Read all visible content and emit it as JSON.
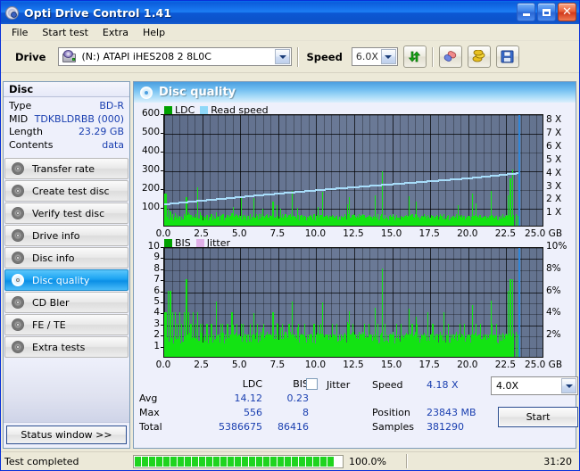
{
  "window": {
    "title": "Opti Drive Control 1.41",
    "icon": "disc-icon",
    "buttons": {
      "minimize": "minimize-icon",
      "maximize": "maximize-icon",
      "close": "close-icon"
    }
  },
  "menu": {
    "items": [
      "File",
      "Start test",
      "Extra",
      "Help"
    ]
  },
  "toolbar": {
    "drive_label": "Drive",
    "drive_value": "(N:)  ATAPI iHES208  2 8L0C",
    "speed_label": "Speed",
    "speed_value": "6.0X",
    "refresh_icon": "refresh-icon",
    "eraser_icon": "eraser-icon",
    "coins_icon": "coins-icon",
    "save_icon": "save-icon"
  },
  "sidebar": {
    "disc_header": "Disc",
    "disc_info": [
      {
        "key": "Type",
        "value": "BD-R"
      },
      {
        "key": "MID",
        "value": "TDKBLDRBB (000)"
      },
      {
        "key": "Length",
        "value": "23.29 GB"
      },
      {
        "key": "Contents",
        "value": "data"
      }
    ],
    "items": [
      {
        "label": "Transfer rate",
        "active": false
      },
      {
        "label": "Create test disc",
        "active": false
      },
      {
        "label": "Verify test disc",
        "active": false
      },
      {
        "label": "Drive info",
        "active": false
      },
      {
        "label": "Disc info",
        "active": false
      },
      {
        "label": "Disc quality",
        "active": true
      },
      {
        "label": "CD Bler",
        "active": false
      },
      {
        "label": "FE / TE",
        "active": false
      },
      {
        "label": "Extra tests",
        "active": false
      }
    ],
    "status_window_label": "Status window >>"
  },
  "panel": {
    "title": "Disc quality",
    "icon": "disc-quality-icon"
  },
  "stats": {
    "col_ldc": "LDC",
    "col_bis": "BIS",
    "rows": [
      {
        "label": "Avg",
        "ldc": "14.12",
        "bis": "0.23"
      },
      {
        "label": "Max",
        "ldc": "556",
        "bis": "8"
      },
      {
        "label": "Total",
        "ldc": "5386675",
        "bis": "86416"
      }
    ],
    "jitter_label": "Jitter",
    "jitter_checked": false,
    "speed_label": "Speed",
    "speed_value": "4.18 X",
    "position_label": "Position",
    "position_value": "23843 MB",
    "samples_label": "Samples",
    "samples_value": "381290",
    "speed_select": "4.0X",
    "start_label": "Start"
  },
  "statusbar": {
    "message": "Test completed",
    "percent": "100.0%",
    "elapsed": "31:20",
    "progress_value": 100
  },
  "chart_data": [
    {
      "id": "ldc-chart",
      "type": "bar",
      "title": "",
      "legend": [
        {
          "name": "LDC",
          "color": "#00a000"
        },
        {
          "name": "Read speed",
          "color": "#8fd8f8"
        }
      ],
      "legend_position": "top-left",
      "xlabel": "GB",
      "ylabel": "",
      "xlim": [
        0,
        25
      ],
      "ylim": [
        0,
        600
      ],
      "xticks": [
        0.0,
        2.5,
        5.0,
        7.5,
        10.0,
        12.5,
        15.0,
        17.5,
        20.0,
        22.5,
        25.0
      ],
      "xticklabels": [
        "0.0",
        "2.5",
        "5.0",
        "7.5",
        "10.0",
        "12.5",
        "15.0",
        "17.5",
        "20.0",
        "22.5",
        "25.0 GB"
      ],
      "yticks": [
        100,
        200,
        300,
        400,
        500,
        600
      ],
      "yticklabels": [
        "100",
        "200",
        "300",
        "400",
        "500",
        "600"
      ],
      "y2lim": [
        0,
        8.5
      ],
      "y2ticks": [
        1,
        2,
        3,
        4,
        5,
        6,
        7,
        8
      ],
      "y2ticklabels": [
        "1 X",
        "2 X",
        "3 X",
        "4 X",
        "5 X",
        "6 X",
        "7 X",
        "8 X"
      ],
      "grid": true,
      "data_end_x": 23.29,
      "series": [
        {
          "name": "LDC",
          "color": "#13e313",
          "note": "error counts per sample across disc",
          "x": [
            0.05,
            0.2,
            0.35,
            0.5,
            0.65,
            0.8,
            0.95,
            1.1,
            1.25,
            1.4,
            1.55,
            1.7,
            1.85,
            2.0,
            2.15,
            2.3,
            2.45,
            2.6,
            2.75,
            2.9,
            3.05,
            3.2,
            3.35,
            3.5,
            3.65,
            3.8,
            3.95,
            4.1,
            4.25,
            4.4,
            4.55,
            4.7,
            4.85,
            5.0,
            5.15,
            5.3,
            5.45,
            5.6,
            5.75,
            5.9,
            6.05,
            6.2,
            6.35,
            6.5,
            6.65,
            6.8,
            6.95,
            7.1,
            7.25,
            7.4,
            7.55,
            7.7,
            7.85,
            8.0,
            8.15,
            8.3,
            8.45,
            8.6,
            8.75,
            8.9,
            9.05,
            9.2,
            9.35,
            9.5,
            9.65,
            9.8,
            9.95,
            10.1,
            10.25,
            10.4,
            10.55,
            10.7,
            10.85,
            11.0,
            11.15,
            11.3,
            11.45,
            11.6,
            11.75,
            11.9,
            12.05,
            12.2,
            12.35,
            12.5,
            12.65,
            12.8,
            12.95,
            13.1,
            13.25,
            13.4,
            13.55,
            13.7,
            13.85,
            14.0,
            14.15,
            14.3,
            14.45,
            14.6,
            14.75,
            14.9,
            15.05,
            15.2,
            15.35,
            15.5,
            15.65,
            15.8,
            15.95,
            16.1,
            16.25,
            16.4,
            16.55,
            16.7,
            16.85,
            17.0,
            17.15,
            17.3,
            17.45,
            17.6,
            17.75,
            17.9,
            18.05,
            18.2,
            18.35,
            18.5,
            18.65,
            18.8,
            18.95,
            19.1,
            19.25,
            19.4,
            19.55,
            19.7,
            19.85,
            20.0,
            20.15,
            20.3,
            20.45,
            20.6,
            20.75,
            20.9,
            21.05,
            21.2,
            21.35,
            21.5,
            21.65,
            21.8,
            21.95,
            22.1,
            22.25,
            22.4,
            22.55,
            22.7,
            22.85,
            23.0,
            23.15,
            23.25
          ],
          "y": [
            170,
            92,
            74,
            60,
            66,
            56,
            52,
            48,
            62,
            150,
            70,
            58,
            50,
            64,
            205,
            72,
            54,
            48,
            56,
            44,
            60,
            52,
            70,
            46,
            54,
            62,
            44,
            58,
            50,
            66,
            48,
            56,
            44,
            150,
            58,
            46,
            52,
            64,
            48,
            42,
            54,
            60,
            46,
            52,
            58,
            44,
            50,
            130,
            46,
            54,
            48,
            62,
            50,
            44,
            56,
            48,
            52,
            46,
            58,
            50,
            44,
            54,
            48,
            52,
            46,
            60,
            50,
            44,
            56,
            48,
            52,
            46,
            50,
            58,
            44,
            54,
            48,
            52,
            46,
            50,
            60,
            44,
            56,
            48,
            52,
            46,
            50,
            58,
            44,
            54,
            48,
            52,
            46,
            60,
            50,
            290,
            56,
            48,
            52,
            46,
            50,
            58,
            44,
            54,
            48,
            52,
            46,
            50,
            60,
            44,
            56,
            48,
            52,
            46,
            50,
            58,
            44,
            54,
            48,
            52,
            46,
            50,
            60,
            44,
            56,
            48,
            52,
            46,
            110,
            58,
            44,
            54,
            48,
            52,
            46,
            50,
            120,
            44,
            56,
            48,
            52,
            46,
            50,
            58,
            44,
            54,
            48,
            52,
            46,
            50,
            160,
            250,
            300
          ]
        },
        {
          "name": "Read speed",
          "color": "#a8ddfa",
          "note": "CAV read speed ramp, X units",
          "x": [
            0,
            1,
            2,
            3,
            4,
            5,
            6,
            7,
            8,
            9,
            10,
            11,
            12,
            13,
            14,
            15,
            16,
            17,
            18,
            19,
            20,
            21,
            22,
            23,
            23.29
          ],
          "y_x": [
            1.82,
            1.93,
            2.05,
            2.15,
            2.26,
            2.37,
            2.48,
            2.58,
            2.68,
            2.78,
            2.88,
            2.98,
            3.07,
            3.16,
            3.25,
            3.34,
            3.43,
            3.52,
            3.61,
            3.7,
            3.79,
            3.9,
            4.02,
            4.14,
            4.18
          ]
        }
      ]
    },
    {
      "id": "bis-chart",
      "type": "bar",
      "title": "",
      "legend": [
        {
          "name": "BIS",
          "color": "#00a000"
        },
        {
          "name": "Jitter",
          "color": "#e0b0e8"
        }
      ],
      "legend_position": "top-left",
      "xlabel": "GB",
      "ylabel": "",
      "xlim": [
        0,
        25
      ],
      "ylim": [
        0,
        10
      ],
      "xticks": [
        0.0,
        2.5,
        5.0,
        7.5,
        10.0,
        12.5,
        15.0,
        17.5,
        20.0,
        22.5,
        25.0
      ],
      "xticklabels": [
        "0.0",
        "2.5",
        "5.0",
        "7.5",
        "10.0",
        "12.5",
        "15.0",
        "17.5",
        "20.0",
        "22.5",
        "25.0 GB"
      ],
      "yticks": [
        1,
        2,
        3,
        4,
        5,
        6,
        7,
        8,
        9,
        10
      ],
      "yticklabels": [
        "1",
        "2",
        "3",
        "4",
        "5",
        "6",
        "7",
        "8",
        "9",
        "10"
      ],
      "y2lim": [
        0,
        10
      ],
      "y2ticks": [
        2,
        4,
        6,
        8,
        10
      ],
      "y2ticklabels": [
        "2%",
        "4%",
        "6%",
        "8%",
        "10%"
      ],
      "grid": true,
      "data_end_x": 23.29,
      "series": [
        {
          "name": "BIS",
          "color": "#13e313",
          "note": "burst indicator subcode errors per sample",
          "x": [
            0.05,
            0.2,
            0.35,
            0.5,
            0.65,
            0.8,
            0.95,
            1.1,
            1.25,
            1.4,
            1.55,
            1.7,
            1.85,
            2.0,
            2.15,
            2.3,
            2.45,
            2.6,
            2.75,
            2.9,
            3.05,
            3.2,
            3.35,
            3.5,
            3.65,
            3.8,
            3.95,
            4.1,
            4.25,
            4.4,
            4.55,
            4.7,
            4.85,
            5.0,
            5.15,
            5.3,
            5.45,
            5.6,
            5.75,
            5.9,
            6.05,
            6.2,
            6.35,
            6.5,
            6.65,
            6.8,
            6.95,
            7.1,
            7.25,
            7.4,
            7.55,
            7.7,
            7.85,
            8.0,
            8.15,
            8.3,
            8.45,
            8.6,
            8.75,
            8.9,
            9.05,
            9.2,
            9.35,
            9.5,
            9.65,
            9.8,
            9.95,
            10.1,
            10.25,
            10.4,
            10.55,
            10.7,
            10.85,
            11.0,
            11.15,
            11.3,
            11.45,
            11.6,
            11.75,
            11.9,
            12.05,
            12.2,
            12.35,
            12.5,
            12.65,
            12.8,
            12.95,
            13.1,
            13.25,
            13.4,
            13.55,
            13.7,
            13.85,
            14.0,
            14.15,
            14.3,
            14.45,
            14.6,
            14.75,
            14.9,
            15.05,
            15.2,
            15.35,
            15.5,
            15.65,
            15.8,
            15.95,
            16.1,
            16.25,
            16.4,
            16.55,
            16.7,
            16.85,
            17.0,
            17.15,
            17.3,
            17.45,
            17.6,
            17.75,
            17.9,
            18.05,
            18.2,
            18.35,
            18.5,
            18.65,
            18.8,
            18.95,
            19.1,
            19.25,
            19.4,
            19.55,
            19.7,
            19.85,
            20.0,
            20.15,
            20.3,
            20.45,
            20.6,
            20.75,
            20.9,
            21.05,
            21.2,
            21.35,
            21.5,
            21.65,
            21.8,
            21.95,
            22.1,
            22.25,
            22.4,
            22.55,
            22.7,
            22.85,
            23.0,
            23.15,
            23.25
          ],
          "y": [
            4,
            6,
            6,
            4,
            4,
            3,
            4,
            3,
            4,
            7,
            4,
            3,
            4,
            3,
            4,
            3,
            3,
            2,
            3,
            2,
            3,
            2,
            5,
            2,
            3,
            3,
            2,
            3,
            2,
            4,
            2,
            3,
            2,
            3,
            3,
            2,
            2,
            3,
            2,
            2,
            3,
            2,
            2,
            3,
            2,
            2,
            2,
            4,
            2,
            3,
            2,
            3,
            2,
            2,
            3,
            2,
            2,
            2,
            3,
            2,
            2,
            3,
            2,
            2,
            2,
            3,
            2,
            2,
            3,
            2,
            2,
            2,
            2,
            3,
            2,
            3,
            2,
            2,
            2,
            2,
            3,
            2,
            3,
            2,
            2,
            2,
            2,
            3,
            2,
            3,
            2,
            2,
            2,
            3,
            2,
            8,
            3,
            2,
            2,
            2,
            2,
            3,
            2,
            3,
            2,
            2,
            2,
            2,
            3,
            2,
            3,
            2,
            2,
            2,
            2,
            4,
            2,
            3,
            2,
            2,
            2,
            2,
            4,
            2,
            3,
            2,
            2,
            2,
            2,
            3,
            2,
            3,
            2,
            2,
            2,
            2,
            3,
            2,
            3,
            2,
            2,
            2,
            2,
            3,
            2,
            3,
            2,
            2,
            2,
            2,
            6,
            7,
            7
          ]
        }
      ]
    }
  ]
}
